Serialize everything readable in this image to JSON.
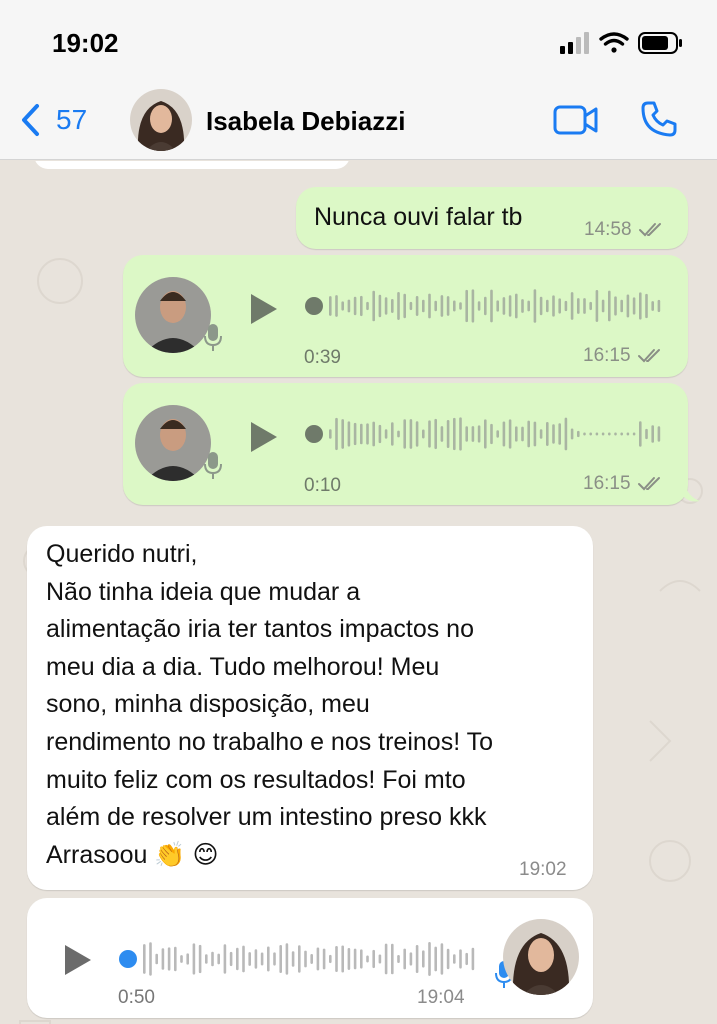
{
  "status_bar": {
    "time": "19:02"
  },
  "header": {
    "back_count": "57",
    "contact_name": "Isabela Debiazzi"
  },
  "messages": [
    {
      "type": "text",
      "direction": "outgoing",
      "text": "Nunca ouvi falar tb",
      "time": "14:58",
      "read": true
    },
    {
      "type": "voice",
      "direction": "outgoing",
      "duration": "0:39",
      "time": "16:15",
      "read": true
    },
    {
      "type": "voice",
      "direction": "outgoing",
      "duration": "0:10",
      "time": "16:15",
      "read": true
    },
    {
      "type": "text",
      "direction": "incoming",
      "lines": [
        "Querido nutri,",
        "Não tinha ideia que mudar a",
        "alimentação iria ter tantos impactos no",
        "meu dia a dia. Tudo melhorou! Meu",
        "sono, minha disposição, meu",
        "rendimento no trabalho e nos treinos! To",
        "muito feliz com os resultados! Foi mto",
        "além de resolver um intestino preso kkk",
        "Arrasoou 👏 😊"
      ],
      "time": "19:02"
    },
    {
      "type": "voice",
      "direction": "incoming",
      "duration": "0:50",
      "time": "19:04"
    }
  ],
  "colors": {
    "accent": "#1a7bf2",
    "outgoing_bubble": "#dcf8c6",
    "incoming_bubble": "#ffffff",
    "chat_background": "#e8e3dc",
    "waveform_outgoing": "#a9b5a2",
    "waveform_incoming": "#b9b9b9",
    "voice_progress_incoming": "#2d8cf0"
  },
  "icons": {
    "back": "chevron-left-icon",
    "video": "video-camera-icon",
    "call": "phone-icon",
    "play": "play-icon",
    "mic": "microphone-icon",
    "read": "double-check-icon"
  }
}
